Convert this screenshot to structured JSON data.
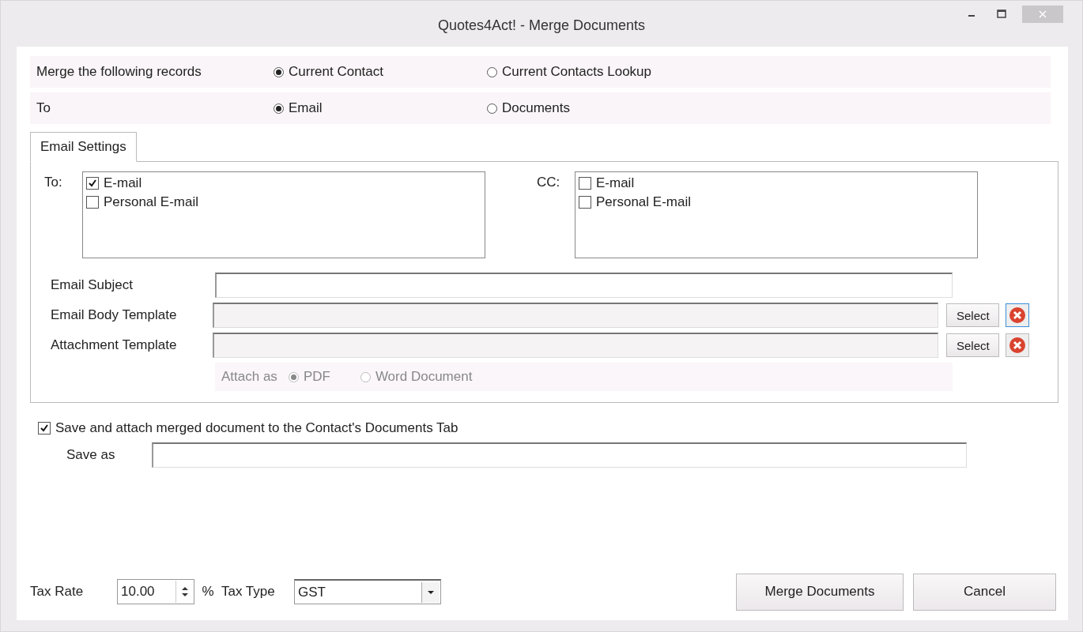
{
  "window": {
    "title": "Quotes4Act! - Merge Documents"
  },
  "option_rows": [
    {
      "label": "Merge the following records",
      "options": [
        {
          "label": "Current Contact",
          "selected": true
        },
        {
          "label": "Current Contacts Lookup",
          "selected": false
        }
      ]
    },
    {
      "label": "To",
      "options": [
        {
          "label": "Email",
          "selected": true
        },
        {
          "label": "Documents",
          "selected": false
        }
      ]
    }
  ],
  "tabs": [
    {
      "label": "Email Settings",
      "selected": true
    }
  ],
  "recipient_lists": [
    {
      "label": "To:",
      "items": [
        {
          "label": "E-mail",
          "checked": true
        },
        {
          "label": "Personal E-mail",
          "checked": false
        }
      ]
    },
    {
      "label": "CC:",
      "items": [
        {
          "label": "E-mail",
          "checked": false
        },
        {
          "label": "Personal E-mail",
          "checked": false
        }
      ]
    }
  ],
  "fields": [
    {
      "kind": "text",
      "label": "Email Subject",
      "disabled": false
    },
    {
      "kind": "template",
      "label": "Email Body Template",
      "disabled": true,
      "button": "Select",
      "focused": true
    },
    {
      "kind": "template",
      "label": "Attachment Template",
      "disabled": true,
      "button": "Select",
      "focused": false
    }
  ],
  "attach_as": {
    "label": "Attach as",
    "disabled": true,
    "options": [
      {
        "label": "PDF",
        "selected": true
      },
      {
        "label": "Word Document",
        "selected": false
      }
    ]
  },
  "save_attach": {
    "label": "Save and attach merged document to the Contact's Documents Tab",
    "checked": true
  },
  "save_as": {
    "label": "Save as"
  },
  "tax_rate": {
    "label": "Tax Rate",
    "value": "10.00",
    "unit": "%"
  },
  "tax_type": {
    "label": "Tax Type",
    "value": "GST"
  },
  "buttons": [
    "Merge Documents",
    "Cancel"
  ]
}
